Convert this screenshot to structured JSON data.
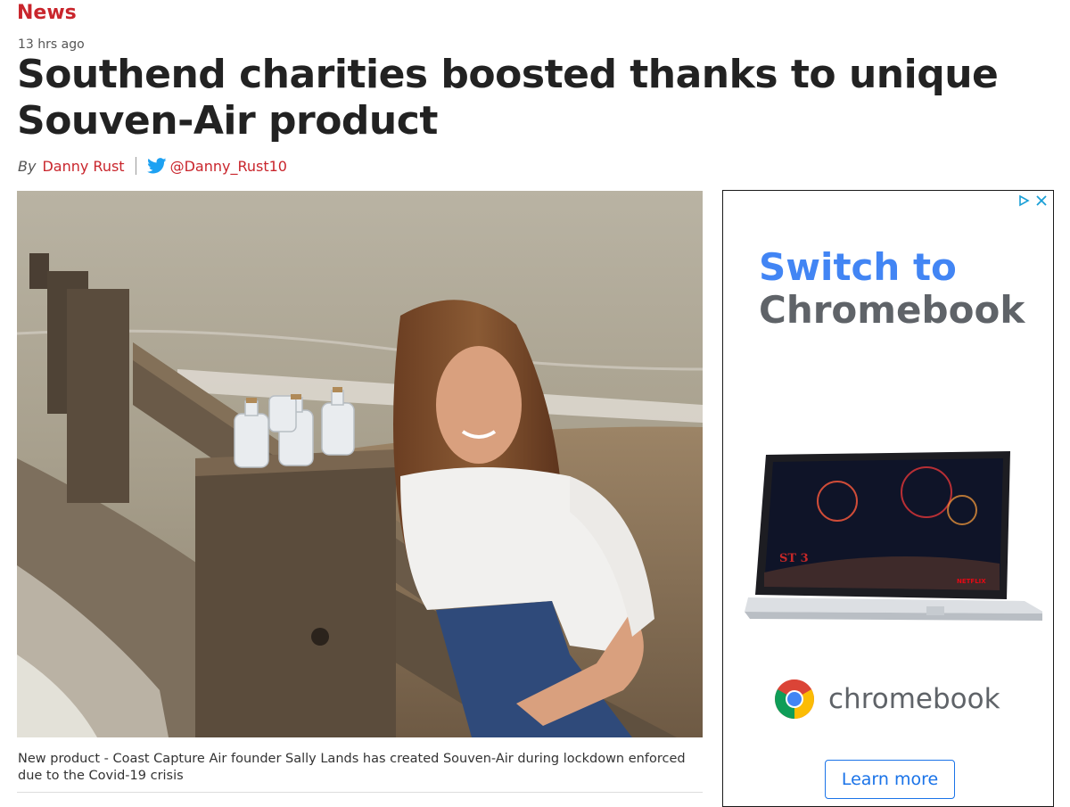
{
  "article": {
    "section": "News",
    "time_ago": "13 hrs ago",
    "title": "Southend charities boosted thanks to unique Souven-Air product",
    "byline": {
      "prefix": "By",
      "author": "Danny Rust",
      "twitter_handle": "@Danny_Rust10"
    },
    "image_caption": "New product - Coast Capture Air founder Sally Lands has created Souven-Air during lockdown enforced due to the Covid-19 crisis"
  },
  "ad": {
    "headline_line1": "Switch to",
    "headline_line2": "Chromebook",
    "brand": "chromebook",
    "cta": "Learn more",
    "screen_text": "NETFLIX"
  },
  "colors": {
    "accent_red": "#c9252c",
    "twitter_blue": "#1da1f2",
    "google_blue": "#4285f4",
    "google_gray": "#5f6368"
  },
  "icons": [
    "twitter-icon",
    "adchoices-icon",
    "ad-close-icon",
    "chrome-icon"
  ]
}
